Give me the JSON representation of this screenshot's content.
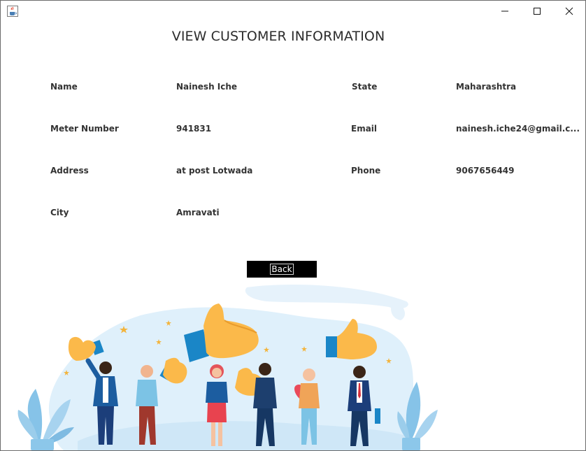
{
  "window": {
    "icons": {
      "app": "java-coffee-icon",
      "minimize": "minimize-icon",
      "maximize": "maximize-icon",
      "close": "close-icon"
    }
  },
  "heading": "VIEW CUSTOMER INFORMATION",
  "fields": {
    "name": {
      "label": "Name",
      "value": "Nainesh Iche"
    },
    "meter": {
      "label": "Meter Number",
      "value": "941831"
    },
    "address": {
      "label": "Address",
      "value": "at post Lotwada"
    },
    "city": {
      "label": "City",
      "value": "Amravati"
    },
    "state": {
      "label": "State",
      "value": "Maharashtra"
    },
    "email": {
      "label": "Email",
      "value": "nainesh.iche24@gmail.c..."
    },
    "phone": {
      "label": "Phone",
      "value": "9067656449"
    }
  },
  "back_label": "Back",
  "colors": {
    "button_bg": "#000000",
    "button_text": "#ffffff",
    "thumb": "#fbb94a",
    "cuff": "#1a86c7",
    "blob": "#dff0fb"
  }
}
